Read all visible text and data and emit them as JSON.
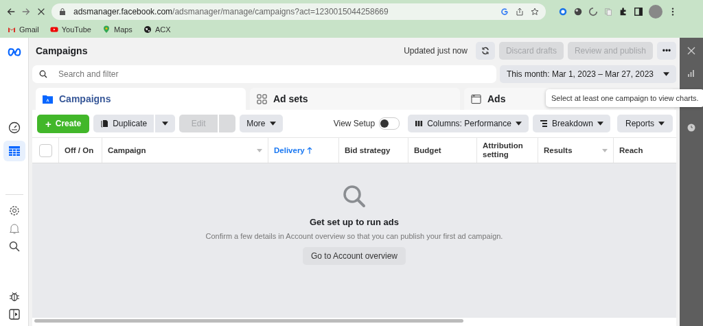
{
  "browser": {
    "url_host": "adsmanager.facebook.com",
    "url_path": "/adsmanager/manage/campaigns?act=1230015044258669",
    "bookmarks": [
      {
        "kind": "gmail",
        "label": "Gmail"
      },
      {
        "kind": "youtube",
        "label": "YouTube"
      },
      {
        "kind": "maps",
        "label": "Maps"
      },
      {
        "kind": "globe",
        "label": "ACX"
      }
    ]
  },
  "sidebar": {
    "items": [
      {
        "kind": "dashboard",
        "selected": false
      },
      {
        "kind": "table",
        "selected": true
      }
    ]
  },
  "header": {
    "title": "Campaigns",
    "status": "Updated just now",
    "buttons": [
      {
        "label": "Discard drafts",
        "disabled": true
      },
      {
        "label": "Review and publish",
        "disabled": true
      }
    ],
    "more": "•••"
  },
  "search": {
    "placeholder": "Search and filter"
  },
  "date_range": "This month: Mar 1, 2023 – Mar 27, 2023",
  "tabs": [
    {
      "kind": "campaigns",
      "label": "Campaigns",
      "selected": true
    },
    {
      "kind": "adsets",
      "label": "Ad sets",
      "selected": false
    },
    {
      "kind": "ads",
      "label": "Ads",
      "selected": false
    }
  ],
  "tooltip": "Select at least one campaign to view charts.",
  "toolbar": {
    "create": {
      "icon": "+",
      "label": "Create"
    },
    "duplicate": "Duplicate",
    "edit": {
      "label": "Edit",
      "disabled": true
    },
    "more": "More",
    "view_setup": {
      "label": "View Setup",
      "on": false
    },
    "columns": "Columns: Performance",
    "breakdown": "Breakdown",
    "reports": "Reports"
  },
  "table": {
    "select_all": {
      "checked": false
    },
    "columns": [
      {
        "label": "Off / On",
        "sorted": false,
        "menu": false
      },
      {
        "label": "Campaign",
        "sorted": false,
        "menu": true
      },
      {
        "label": "Delivery",
        "sorted": true,
        "menu": false
      },
      {
        "label": "Bid strategy",
        "sorted": false,
        "menu": false
      },
      {
        "label": "Budget",
        "sorted": false,
        "menu": false
      },
      {
        "label": "Attribution setting",
        "sorted": false,
        "menu": false
      },
      {
        "label": "Results",
        "sorted": false,
        "menu": true
      },
      {
        "label": "Reach",
        "sorted": false,
        "menu": false
      }
    ]
  },
  "empty_state": {
    "title": "Get set up to run ads",
    "message": "Confirm a few details in Account overview so that you can publish your first ad campaign.",
    "button": "Go to Account overview"
  }
}
